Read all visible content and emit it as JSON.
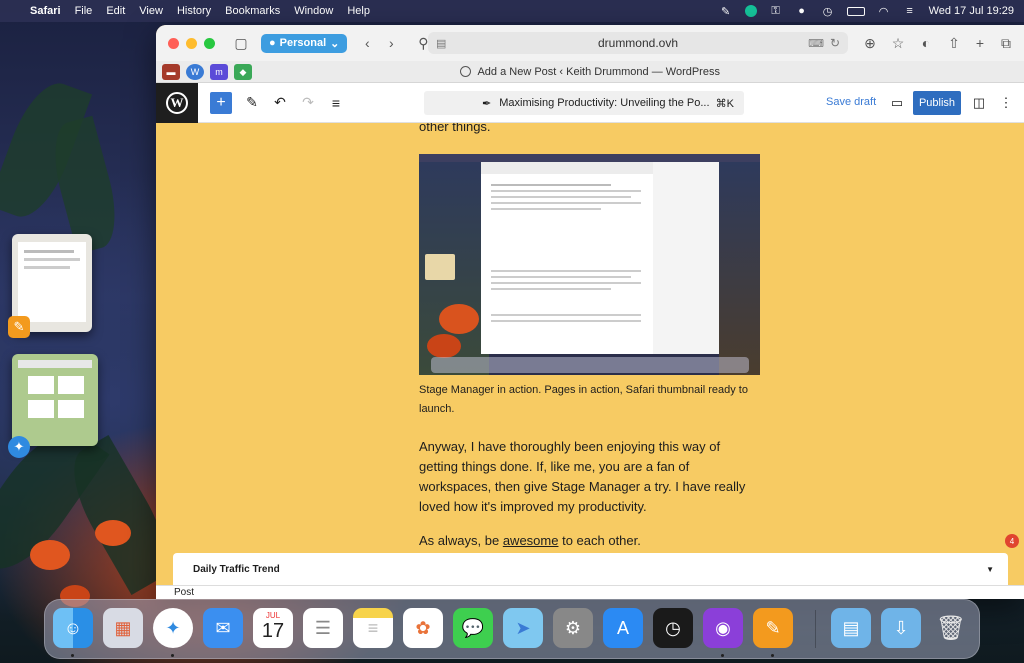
{
  "menubar": {
    "app_name": "Safari",
    "items": [
      "File",
      "Edit",
      "View",
      "History",
      "Bookmarks",
      "Window",
      "Help"
    ],
    "clock": "Wed 17 Jul  19:29"
  },
  "browser": {
    "profile": "Personal",
    "url": "drummond.ovh",
    "tab_title": "Add a New Post ‹ Keith Drummond — WordPress"
  },
  "editor": {
    "post_title_bar": "Maximising Productivity: Unveiling the Po...",
    "shortcut": "⌘K",
    "save_draft": "Save draft",
    "publish": "Publish"
  },
  "content": {
    "top_text": "other things.",
    "caption": "Stage Manager in action. Pages in action, Safari thumbnail ready to launch.",
    "paragraph1": "Anyway, I have thoroughly been enjoying this way of getting things done. If, like me, you are a fan of workspaces, then give Stage Manager a try. I have really loved how it's improved my productivity.",
    "paragraph2_pre": "As always, be ",
    "paragraph2_word": "awesome",
    "paragraph2_post": " to each other."
  },
  "panel": {
    "traffic_label": "Daily Traffic Trend",
    "notification_count": "4",
    "status_label": "Post"
  },
  "dock": {
    "calendar_month": "JUL",
    "calendar_day": "17",
    "apps": [
      "Finder",
      "Launchpad",
      "Safari",
      "Mail",
      "Calendar",
      "Reminders",
      "Notes",
      "Photos",
      "Messages",
      "Maps",
      "System Settings",
      "App Store",
      "Clock",
      "Podcasts",
      "Pages",
      "Downloads Folder",
      "Documents Folder",
      "Trash"
    ]
  },
  "colors": {
    "page_background": "#f7cb63",
    "accent": "#3a7bd5",
    "publish_button": "#2e6dbf"
  }
}
